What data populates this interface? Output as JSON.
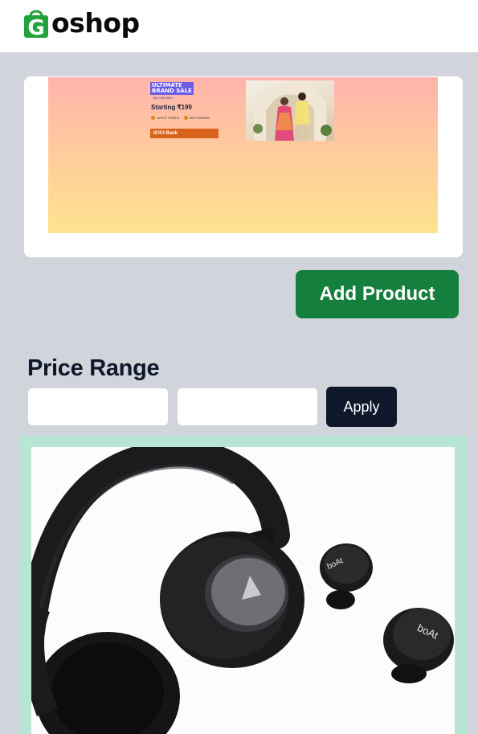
{
  "header": {
    "logo_letter": "G",
    "logo_rest": "oshop"
  },
  "banner": {
    "title_line1": "ULTIMATE",
    "title_line2": "BRAND SALE",
    "dates": "8th-12th MAY",
    "price_text": "Starting ₹199",
    "chip1": "LATEST TRENDS",
    "chip2": "BEST BRANDS",
    "bank_text": "ICICI Bank"
  },
  "actions": {
    "add_product_label": "Add Product"
  },
  "price_filter": {
    "title": "Price Range",
    "min_value": "",
    "max_value": "",
    "apply_label": "Apply"
  },
  "product": {
    "earbud_brand": "boAt"
  },
  "colors": {
    "accent_green": "#15803d",
    "dark_button": "#0f172a",
    "page_bg": "#d1d5db",
    "card_border": "#b7e6d4"
  }
}
